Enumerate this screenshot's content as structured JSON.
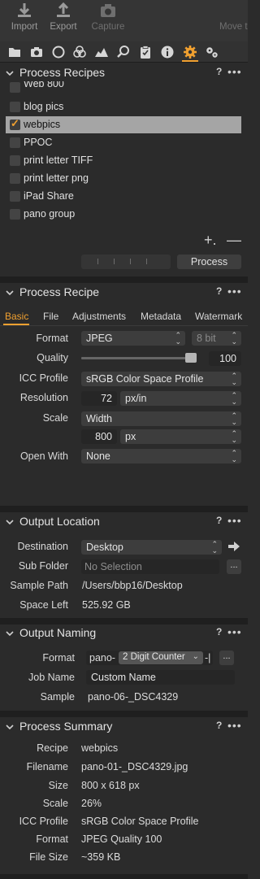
{
  "toolbar": {
    "import_label": "Import",
    "export_label": "Export",
    "capture_label": "Capture",
    "move_label": "Move t"
  },
  "tool_tabs": [
    "folder-icon",
    "camera-icon",
    "lens-icon",
    "color-icon",
    "exposure-icon",
    "search-icon",
    "clipboard-icon",
    "info-icon",
    "gear-icon",
    "gears-icon"
  ],
  "colors": {
    "accent": "#f0a030",
    "panel_bg": "#2b2b2b",
    "selection": "#a5a5a5"
  },
  "process_recipes": {
    "title": "Process Recipes",
    "help": "?",
    "more": "•••",
    "items": [
      {
        "name": "Web 800",
        "checked": false
      },
      {
        "name": "blog pics",
        "checked": false
      },
      {
        "name": "webpics",
        "checked": true
      },
      {
        "name": "PPOC",
        "checked": false
      },
      {
        "name": "print letter TIFF",
        "checked": false
      },
      {
        "name": "print letter png",
        "checked": false
      },
      {
        "name": "iPad Share",
        "checked": false
      },
      {
        "name": "pano group",
        "checked": false
      }
    ],
    "add_label": "+.",
    "remove_label": "—",
    "process_button": "Process"
  },
  "process_recipe": {
    "title": "Process Recipe",
    "help": "?",
    "more": "•••",
    "tabs": [
      "Basic",
      "File",
      "Adjustments",
      "Metadata",
      "Watermark"
    ],
    "active_tab": "Basic",
    "format_label": "Format",
    "format_value": "JPEG",
    "bit_value": "8 bit",
    "quality_label": "Quality",
    "quality_value": "100",
    "quality_fraction": 0.92,
    "icc_label": "ICC Profile",
    "icc_value": "sRGB Color Space Profile",
    "resolution_label": "Resolution",
    "resolution_value": "72",
    "resolution_unit": "px/in",
    "scale_label": "Scale",
    "scale_value": "Width",
    "scale_size": "800",
    "scale_unit": "px",
    "open_with_label": "Open With",
    "open_with_value": "None"
  },
  "output_location": {
    "title": "Output Location",
    "help": "?",
    "more": "•••",
    "destination_label": "Destination",
    "destination_value": "Desktop",
    "subfolder_label": "Sub Folder",
    "subfolder_placeholder": "No Selection",
    "subfolder_button": "...",
    "sample_path_label": "Sample Path",
    "sample_path_value": "/Users/bbp16/Desktop",
    "space_left_label": "Space Left",
    "space_left_value": "525.92 GB"
  },
  "output_naming": {
    "title": "Output Naming",
    "help": "?",
    "more": "•••",
    "format_label": "Format",
    "format_prefix": "pano-",
    "format_token": "2 Digit Counter",
    "format_suffix": "-|",
    "format_button": "...",
    "job_name_label": "Job Name",
    "job_name_value": "Custom Name",
    "sample_label": "Sample",
    "sample_value": "pano-06-_DSC4329"
  },
  "process_summary": {
    "title": "Process Summary",
    "help": "?",
    "more": "•••",
    "rows": [
      {
        "label": "Recipe",
        "value": "webpics"
      },
      {
        "label": "Filename",
        "value": "pano-01-_DSC4329.jpg"
      },
      {
        "label": "Size",
        "value": "800 x 618 px"
      },
      {
        "label": "Scale",
        "value": "26%"
      },
      {
        "label": "ICC Profile",
        "value": "sRGB Color Space Profile"
      },
      {
        "label": "Format",
        "value": "JPEG Quality 100"
      },
      {
        "label": "File Size",
        "value": "~359 KB"
      }
    ]
  }
}
